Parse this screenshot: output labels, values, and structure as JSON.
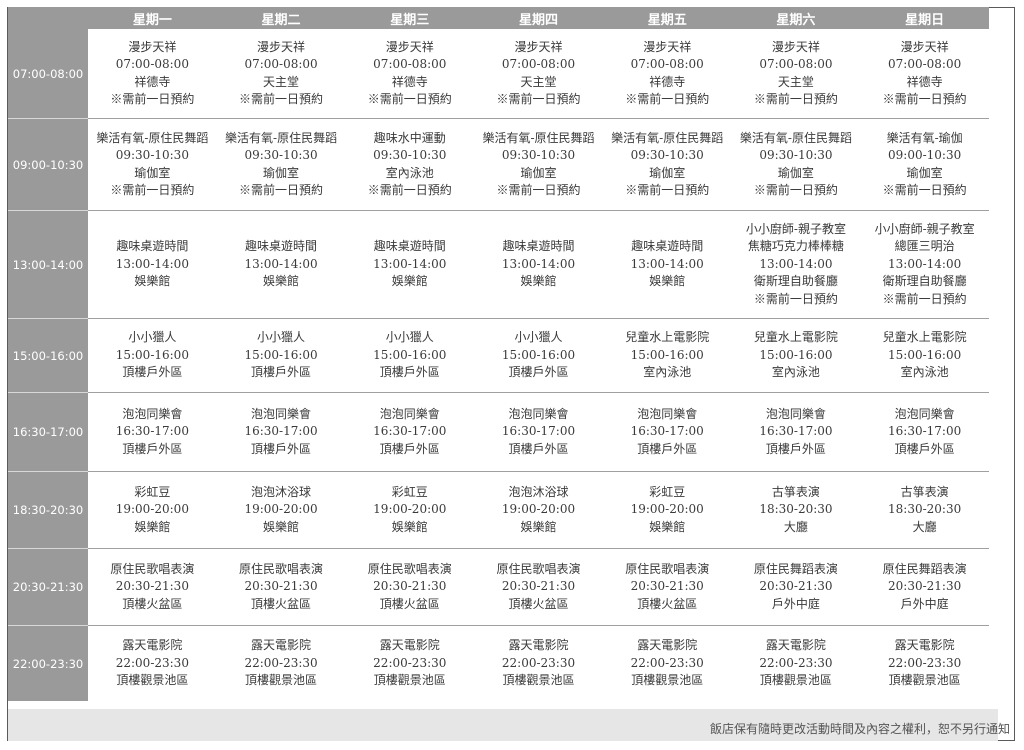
{
  "days": [
    "星期一",
    "星期二",
    "星期三",
    "星期四",
    "星期五",
    "星期六",
    "星期日"
  ],
  "rows": [
    {
      "time": "07:00-08:00",
      "cells": [
        [
          "漫步天祥",
          "07:00-08:00",
          "祥德寺",
          "※需前一日預約"
        ],
        [
          "漫步天祥",
          "07:00-08:00",
          "天主堂",
          "※需前一日預約"
        ],
        [
          "漫步天祥",
          "07:00-08:00",
          "祥德寺",
          "※需前一日預約"
        ],
        [
          "漫步天祥",
          "07:00-08:00",
          "天主堂",
          "※需前一日預約"
        ],
        [
          "漫步天祥",
          "07:00-08:00",
          "祥德寺",
          "※需前一日預約"
        ],
        [
          "漫步天祥",
          "07:00-08:00",
          "天主堂",
          "※需前一日預約"
        ],
        [
          "漫步天祥",
          "07:00-08:00",
          "祥德寺",
          "※需前一日預約"
        ]
      ]
    },
    {
      "time": "09:00-10:30",
      "cells": [
        [
          "樂活有氧-原住民舞蹈",
          "09:30-10:30",
          "瑜伽室",
          "※需前一日預約"
        ],
        [
          "樂活有氧-原住民舞蹈",
          "09:30-10:30",
          "瑜伽室",
          "※需前一日預約"
        ],
        [
          "趣味水中運動",
          "09:30-10:30",
          "室內泳池",
          "※需前一日預約"
        ],
        [
          "樂活有氧-原住民舞蹈",
          "09:30-10:30",
          "瑜伽室",
          "※需前一日預約"
        ],
        [
          "樂活有氧-原住民舞蹈",
          "09:30-10:30",
          "瑜伽室",
          "※需前一日預約"
        ],
        [
          "樂活有氧-原住民舞蹈",
          "09:30-10:30",
          "瑜伽室",
          "※需前一日預約"
        ],
        [
          "樂活有氧-瑜伽",
          "09:00-10:30",
          "瑜伽室",
          "※需前一日預約"
        ]
      ]
    },
    {
      "time": "13:00-14:00",
      "cells": [
        [
          "趣味桌遊時間",
          "13:00-14:00",
          "娛樂館"
        ],
        [
          "趣味桌遊時間",
          "13:00-14:00",
          "娛樂館"
        ],
        [
          "趣味桌遊時間",
          "13:00-14:00",
          "娛樂館"
        ],
        [
          "趣味桌遊時間",
          "13:00-14:00",
          "娛樂館"
        ],
        [
          "趣味桌遊時間",
          "13:00-14:00",
          "娛樂館"
        ],
        [
          "小小廚師-親子教室",
          "焦糖巧克力棒棒糖",
          "13:00-14:00",
          "衛斯理自助餐廳",
          "※需前一日預約"
        ],
        [
          "小小廚師-親子教室",
          "總匯三明治",
          "13:00-14:00",
          "衛斯理自助餐廳",
          "※需前一日預約"
        ]
      ]
    },
    {
      "time": "15:00-16:00",
      "cells": [
        [
          "小小獵人",
          "15:00-16:00",
          "頂樓戶外區"
        ],
        [
          "小小獵人",
          "15:00-16:00",
          "頂樓戶外區"
        ],
        [
          "小小獵人",
          "15:00-16:00",
          "頂樓戶外區"
        ],
        [
          "小小獵人",
          "15:00-16:00",
          "頂樓戶外區"
        ],
        [
          "兒童水上電影院",
          "15:00-16:00",
          "室內泳池"
        ],
        [
          "兒童水上電影院",
          "15:00-16:00",
          "室內泳池"
        ],
        [
          "兒童水上電影院",
          "15:00-16:00",
          "室內泳池"
        ]
      ]
    },
    {
      "time": "16:30-17:00",
      "cells": [
        [
          "泡泡同樂會",
          "16:30-17:00",
          "頂樓戶外區"
        ],
        [
          "泡泡同樂會",
          "16:30-17:00",
          "頂樓戶外區"
        ],
        [
          "泡泡同樂會",
          "16:30-17:00",
          "頂樓戶外區"
        ],
        [
          "泡泡同樂會",
          "16:30-17:00",
          "頂樓戶外區"
        ],
        [
          "泡泡同樂會",
          "16:30-17:00",
          "頂樓戶外區"
        ],
        [
          "泡泡同樂會",
          "16:30-17:00",
          "頂樓戶外區"
        ],
        [
          "泡泡同樂會",
          "16:30-17:00",
          "頂樓戶外區"
        ]
      ]
    },
    {
      "time": "18:30-20:30",
      "cells": [
        [
          "彩虹豆",
          "19:00-20:00",
          "娛樂館"
        ],
        [
          "泡泡沐浴球",
          "19:00-20:00",
          "娛樂館"
        ],
        [
          "彩虹豆",
          "19:00-20:00",
          "娛樂館"
        ],
        [
          "泡泡沐浴球",
          "19:00-20:00",
          "娛樂館"
        ],
        [
          "彩虹豆",
          "19:00-20:00",
          "娛樂館"
        ],
        [
          "古箏表演",
          "18:30-20:30",
          "大廳"
        ],
        [
          "古箏表演",
          "18:30-20:30",
          "大廳"
        ]
      ]
    },
    {
      "time": "20:30-21:30",
      "cells": [
        [
          "原住民歌唱表演",
          "20:30-21:30",
          "頂樓火盆區"
        ],
        [
          "原住民歌唱表演",
          "20:30-21:30",
          "頂樓火盆區"
        ],
        [
          "原住民歌唱表演",
          "20:30-21:30",
          "頂樓火盆區"
        ],
        [
          "原住民歌唱表演",
          "20:30-21:30",
          "頂樓火盆區"
        ],
        [
          "原住民歌唱表演",
          "20:30-21:30",
          "頂樓火盆區"
        ],
        [
          "原住民舞蹈表演",
          "20:30-21:30",
          "戶外中庭"
        ],
        [
          "原住民舞蹈表演",
          "20:30-21:30",
          "戶外中庭"
        ]
      ]
    },
    {
      "time": "22:00-23:30",
      "cells": [
        [
          "露天電影院",
          "22:00-23:30",
          "頂樓觀景池區"
        ],
        [
          "露天電影院",
          "22:00-23:30",
          "頂樓觀景池區"
        ],
        [
          "露天電影院",
          "22:00-23:30",
          "頂樓觀景池區"
        ],
        [
          "露天電影院",
          "22:00-23:30",
          "頂樓觀景池區"
        ],
        [
          "露天電影院",
          "22:00-23:30",
          "頂樓觀景池區"
        ],
        [
          "露天電影院",
          "22:00-23:30",
          "頂樓觀景池區"
        ],
        [
          "露天電影院",
          "22:00-23:30",
          "頂樓觀景池區"
        ]
      ]
    }
  ],
  "footer": {
    "note": "飯店保有隨時更改活動時間及內容之權利，恕不另行通知"
  },
  "colors": {
    "header_bg": "#9a9a9a",
    "grid_line": "#a0a0a0",
    "text": "#3a3a3a",
    "footer_bg": "#e6e6e6"
  }
}
